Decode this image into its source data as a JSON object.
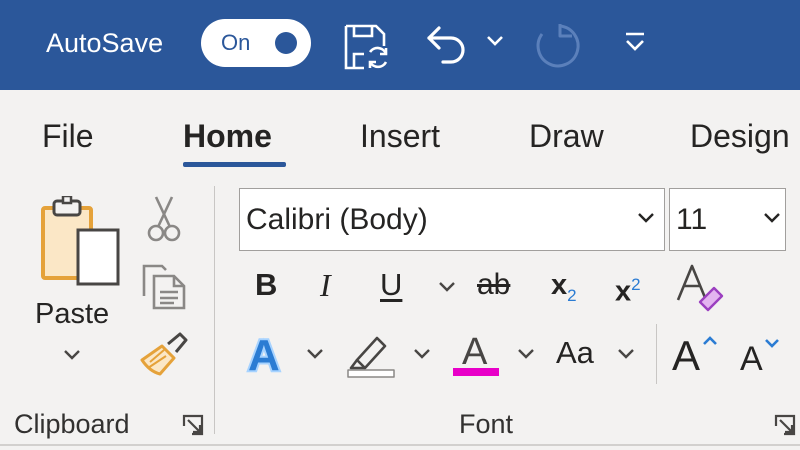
{
  "title_bar": {
    "autosave_label": "AutoSave",
    "autosave_state": "On",
    "icons": [
      "save-icon",
      "undo-icon",
      "undo-dropdown-icon",
      "redo-icon",
      "customize-quick-access-icon"
    ],
    "background_color": "#2b579a"
  },
  "tabs": [
    {
      "label": "File"
    },
    {
      "label": "Home",
      "active": true
    },
    {
      "label": "Insert"
    },
    {
      "label": "Draw"
    },
    {
      "label": "Design"
    }
  ],
  "clipboard": {
    "paste_label": "Paste",
    "group_label": "Clipboard",
    "icons": [
      "paste-icon",
      "cut-icon",
      "copy-icon",
      "format-painter-icon",
      "dialog-launcher-icon"
    ]
  },
  "font": {
    "font_name": "Calibri (Body)",
    "font_size": "11",
    "bold": "B",
    "italic": "I",
    "underline": "U",
    "strikethrough": "ab",
    "subscript_base": "x",
    "subscript_mark": "2",
    "superscript_base": "x",
    "superscript_mark": "2",
    "text_effects": "A",
    "font_color_letter": "A",
    "change_case": "Aa",
    "grow_font": "A",
    "shrink_font": "A",
    "group_label": "Font",
    "highlight_color": "#ffffff",
    "font_color": "#e800c8",
    "accent_color": "#2b7cd3"
  }
}
